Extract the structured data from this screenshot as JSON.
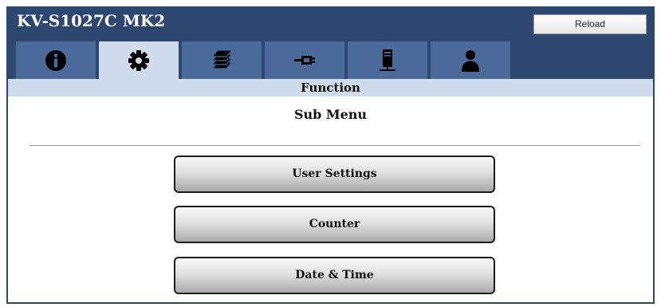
{
  "app": {
    "title": "KV-S1027C MK2",
    "reload_label": "Reload"
  },
  "tabs": [
    {
      "icon": "info-icon",
      "active": false
    },
    {
      "icon": "gear-icon",
      "active": true
    },
    {
      "icon": "paper-stack-icon",
      "active": false
    },
    {
      "icon": "connector-icon",
      "active": false
    },
    {
      "icon": "scanner-device-icon",
      "active": false
    },
    {
      "icon": "user-icon",
      "active": false
    }
  ],
  "section": {
    "title": "Function"
  },
  "submenu": {
    "title": "Sub Menu",
    "buttons": [
      {
        "label": "User Settings"
      },
      {
        "label": "Counter"
      },
      {
        "label": "Date & Time"
      }
    ]
  },
  "colors": {
    "header": "#2d4771",
    "tab_inactive": "#4a6a99",
    "tab_active": "#cfdcec",
    "section_bar": "#cfdcec"
  }
}
